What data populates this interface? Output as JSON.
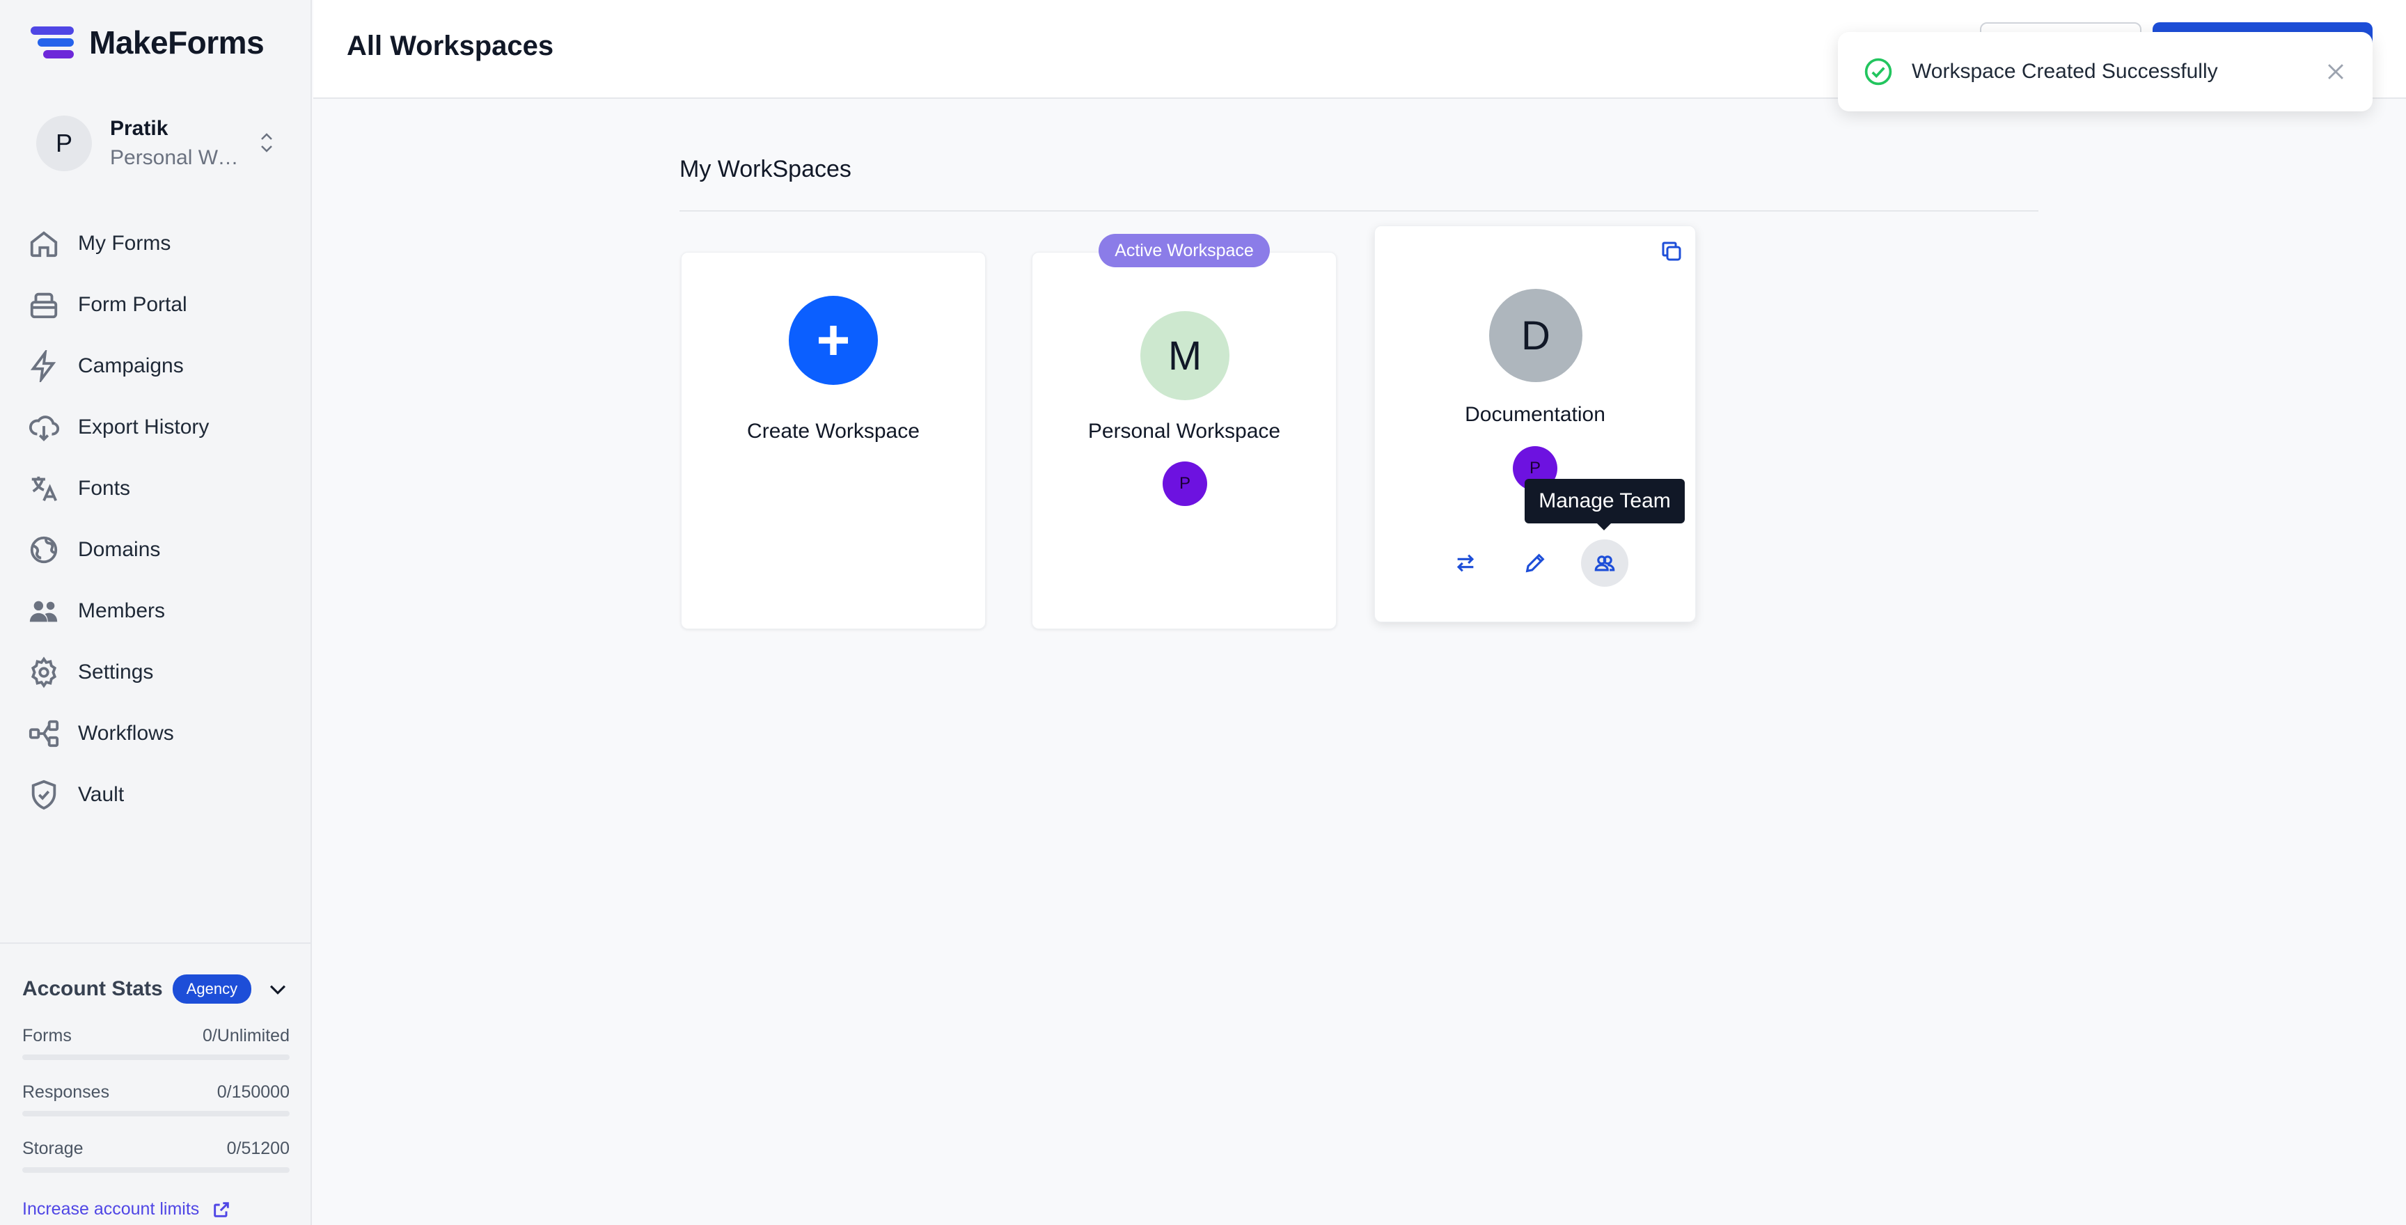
{
  "app": {
    "name": "MakeForms"
  },
  "user": {
    "initial": "P",
    "name": "Pratik",
    "workspace": "Personal Workspace"
  },
  "sidebar": {
    "items": [
      {
        "label": "My Forms",
        "icon": "home-icon"
      },
      {
        "label": "Form Portal",
        "icon": "portal-icon"
      },
      {
        "label": "Campaigns",
        "icon": "bolt-icon"
      },
      {
        "label": "Export History",
        "icon": "cloud-download-icon"
      },
      {
        "label": "Fonts",
        "icon": "translate-icon"
      },
      {
        "label": "Domains",
        "icon": "globe-icon"
      },
      {
        "label": "Members",
        "icon": "users-icon"
      },
      {
        "label": "Settings",
        "icon": "gear-icon"
      },
      {
        "label": "Workflows",
        "icon": "workflow-icon"
      },
      {
        "label": "Vault",
        "icon": "shield-check-icon"
      }
    ]
  },
  "stats": {
    "title": "Account Stats",
    "plan": "Agency",
    "rows": [
      {
        "label": "Forms",
        "value": "0/Unlimited",
        "fraction": 0
      },
      {
        "label": "Responses",
        "value": "0/150000",
        "fraction": 0
      },
      {
        "label": "Storage",
        "value": "0/51200",
        "fraction": 0
      }
    ],
    "increase_label": "Increase account limits"
  },
  "header": {
    "title": "All Workspaces"
  },
  "toast": {
    "message": "Workspace Created Successfully"
  },
  "main": {
    "section_title": "My WorkSpaces",
    "create_label": "Create Workspace",
    "active_badge": "Active Workspace",
    "workspaces": [
      {
        "initial": "M",
        "name": "Personal Workspace",
        "member_initial": "P"
      },
      {
        "initial": "D",
        "name": "Documentation",
        "member_initial": "P"
      }
    ],
    "tooltip": "Manage Team"
  },
  "colors": {
    "primary": "#0b5fff",
    "accent": "#8b7ce8",
    "member": "#6d12e0",
    "success": "#22c55e"
  }
}
